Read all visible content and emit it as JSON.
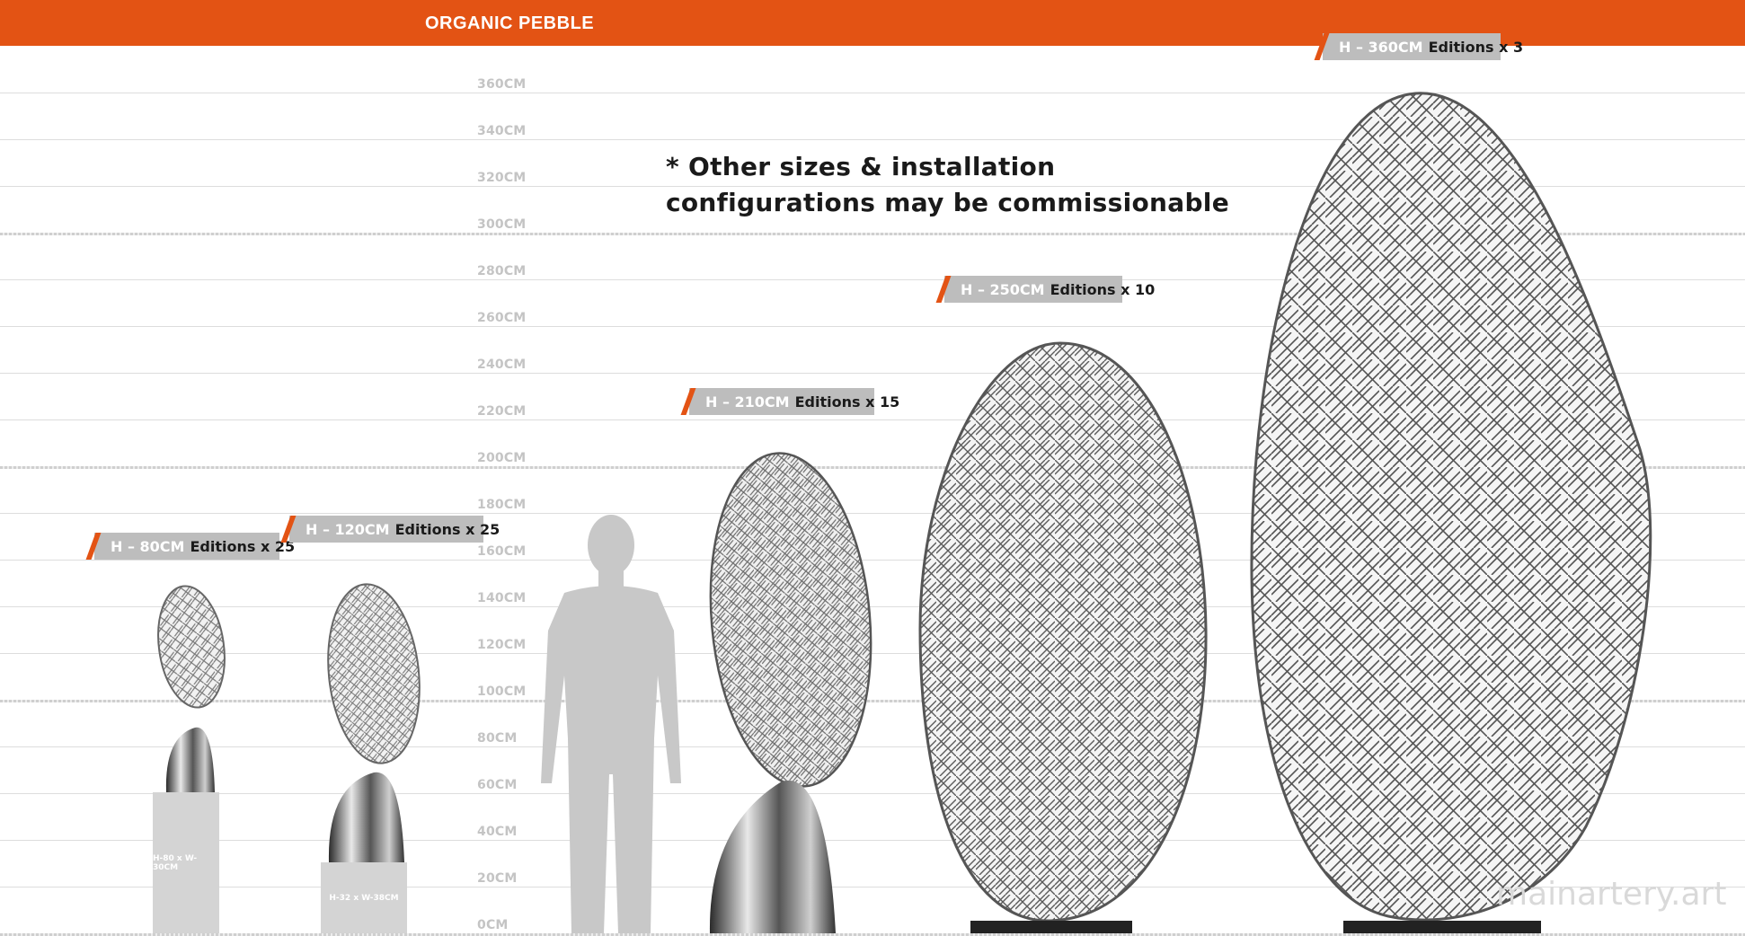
{
  "header": {
    "title": "ORGANIC PEBBLE"
  },
  "scale": {
    "labels": [
      "360CM",
      "340CM",
      "320CM",
      "300CM",
      "280CM",
      "260CM",
      "240CM",
      "220CM",
      "200CM",
      "180CM",
      "160CM",
      "140CM",
      "120CM",
      "100CM",
      "80CM",
      "60CM",
      "40CM",
      "20CM",
      "0CM"
    ]
  },
  "note": {
    "line1": "* Other sizes & installation",
    "line2": "configurations may be commissionable"
  },
  "editions": [
    {
      "height": "H – 80CM",
      "editions": "Editions x 25",
      "plinth": "H-80 x W-30CM"
    },
    {
      "height": "H – 120CM",
      "editions": "Editions x 25",
      "plinth": "H-32 x W-38CM"
    },
    {
      "height": "H – 210CM",
      "editions": "Editions x 15"
    },
    {
      "height": "H – 250CM",
      "editions": "Editions x 10"
    },
    {
      "height": "H – 360CM",
      "editions": "Editions x 3"
    }
  ],
  "watermark": "mainartery.art",
  "colors": {
    "accent": "#e35314",
    "tag": "#bdbdbd",
    "grid": "#dddddd"
  }
}
